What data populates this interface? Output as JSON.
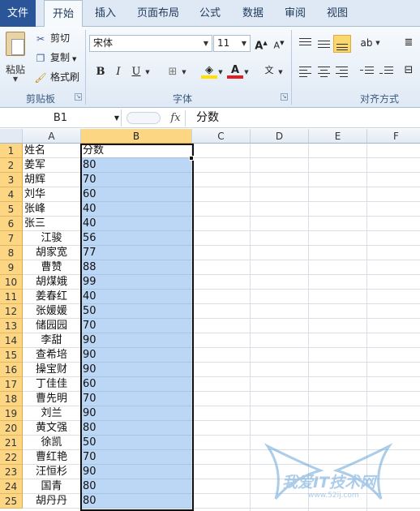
{
  "tabs": [
    "文件",
    "开始",
    "插入",
    "页面布局",
    "公式",
    "数据",
    "审阅",
    "视图"
  ],
  "clipboard": {
    "paste_label": "粘贴",
    "cut_label": "剪切",
    "copy_label": "复制",
    "format_painter_label": "格式刷",
    "group_label": "剪贴板"
  },
  "font": {
    "name": "宋体",
    "size": "11",
    "group_label": "字体",
    "bold": "B",
    "italic": "I",
    "underline": "U"
  },
  "alignment": {
    "group_label": "对齐方式"
  },
  "formula_bar": {
    "name_box": "B1",
    "fx": "fx",
    "content": "分数"
  },
  "columns": [
    "A",
    "B",
    "C",
    "D",
    "E",
    "F"
  ],
  "rows": [
    {
      "n": "1",
      "a": "姓名",
      "b": "分数",
      "indent": false
    },
    {
      "n": "2",
      "a": "姜军",
      "b": "80",
      "indent": false
    },
    {
      "n": "3",
      "a": "胡辉",
      "b": "70",
      "indent": false
    },
    {
      "n": "4",
      "a": "刘华",
      "b": "60",
      "indent": false
    },
    {
      "n": "5",
      "a": "张峰",
      "b": "40",
      "indent": false
    },
    {
      "n": "6",
      "a": "张三",
      "b": "40",
      "indent": false
    },
    {
      "n": "7",
      "a": "江骏",
      "b": "56",
      "indent": true
    },
    {
      "n": "8",
      "a": "胡家宽",
      "b": "77",
      "indent": true
    },
    {
      "n": "9",
      "a": "曹赞",
      "b": "88",
      "indent": true
    },
    {
      "n": "10",
      "a": "胡煤娥",
      "b": "99",
      "indent": true
    },
    {
      "n": "11",
      "a": "姜春红",
      "b": "40",
      "indent": true
    },
    {
      "n": "12",
      "a": "张媛媛",
      "b": "50",
      "indent": true
    },
    {
      "n": "13",
      "a": "储园园",
      "b": "70",
      "indent": true
    },
    {
      "n": "14",
      "a": "李甜",
      "b": "90",
      "indent": true
    },
    {
      "n": "15",
      "a": "查希培",
      "b": "90",
      "indent": true
    },
    {
      "n": "16",
      "a": "操宝财",
      "b": "90",
      "indent": true
    },
    {
      "n": "17",
      "a": "丁佳佳",
      "b": "60",
      "indent": true
    },
    {
      "n": "18",
      "a": "曹先明",
      "b": "70",
      "indent": true
    },
    {
      "n": "19",
      "a": "刘兰",
      "b": "90",
      "indent": true
    },
    {
      "n": "20",
      "a": "黄文强",
      "b": "80",
      "indent": true
    },
    {
      "n": "21",
      "a": "徐凯",
      "b": "50",
      "indent": true
    },
    {
      "n": "22",
      "a": "曹红艳",
      "b": "70",
      "indent": true
    },
    {
      "n": "23",
      "a": "汪恒杉",
      "b": "90",
      "indent": true
    },
    {
      "n": "24",
      "a": "国青",
      "b": "80",
      "indent": true
    },
    {
      "n": "25",
      "a": "胡丹丹",
      "b": "80",
      "indent": true
    }
  ],
  "watermark": {
    "text": "我爱IT技术网",
    "sub": "www.52ij.com"
  },
  "colors": {
    "file_tab": "#2a5699",
    "selection_fill": "#bcd6f5",
    "header_selected": "#fcd683"
  }
}
